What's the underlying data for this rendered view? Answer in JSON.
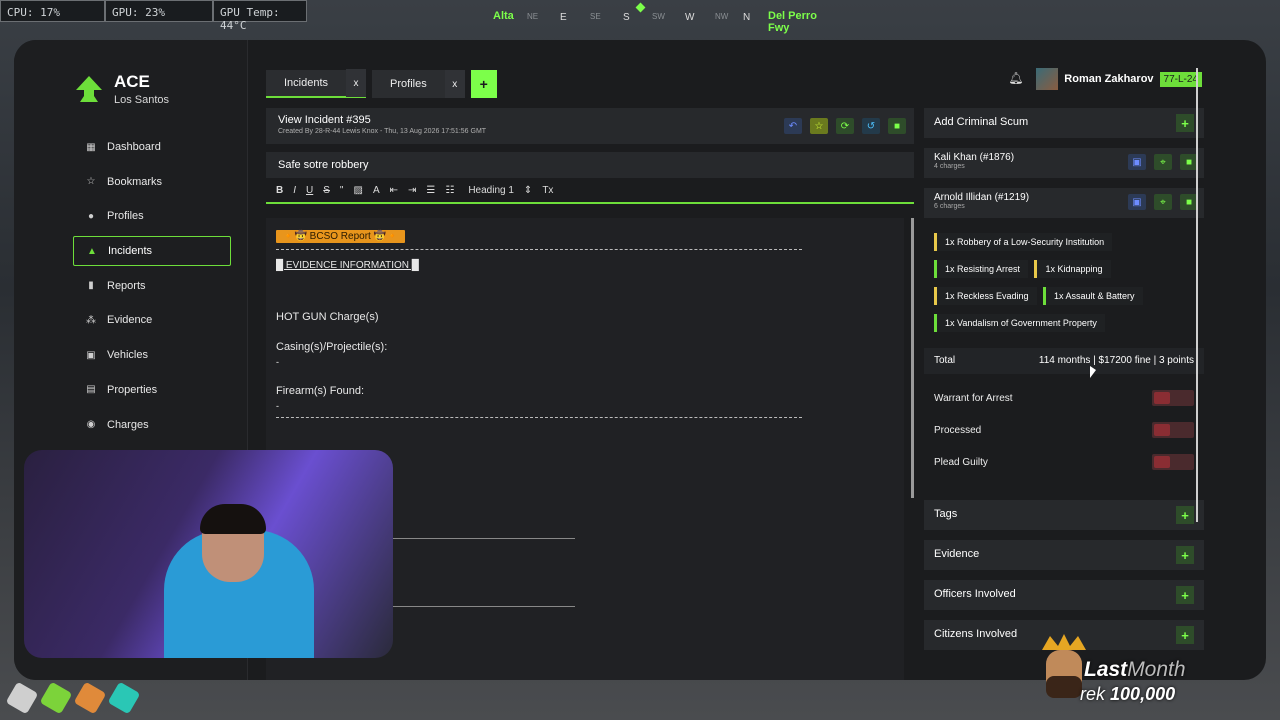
{
  "hud": {
    "cpu": "CPU: 17%",
    "gpu": "GPU: 23%",
    "gpu_temp": "GPU Temp: 44°C"
  },
  "compass": {
    "left_street": "Alta",
    "right_street": "Del Perro Fwy",
    "dirs": [
      "NE",
      "E",
      "SE",
      "S",
      "SW",
      "W",
      "NW",
      "N"
    ]
  },
  "brand": {
    "title": "ACE",
    "subtitle": "Los Santos"
  },
  "nav": [
    {
      "label": "Dashboard",
      "icon": "dashboard-icon"
    },
    {
      "label": "Bookmarks",
      "icon": "star-icon"
    },
    {
      "label": "Profiles",
      "icon": "user-icon"
    },
    {
      "label": "Incidents",
      "icon": "warning-icon",
      "active": true
    },
    {
      "label": "Reports",
      "icon": "file-icon"
    },
    {
      "label": "Evidence",
      "icon": "footprint-icon"
    },
    {
      "label": "Vehicles",
      "icon": "car-icon"
    },
    {
      "label": "Properties",
      "icon": "building-icon"
    },
    {
      "label": "Charges",
      "icon": "pin-icon"
    }
  ],
  "tabs": [
    {
      "label": "Incidents",
      "close": "x"
    },
    {
      "label": "Profiles",
      "close": "x"
    }
  ],
  "tab_add": "+",
  "user": {
    "name": "Roman Zakharov",
    "callsign": "77-L-24"
  },
  "incident": {
    "title": "View Incident #395",
    "meta": "Created By 28-R-44 Lewis Knox - Thu, 13 Aug 2026 17:51:56 GMT",
    "name": "Safe sotre robbery",
    "toolbar": {
      "bold": "B",
      "italic": "I",
      "underline": "U",
      "strike": "S",
      "quote": "\"",
      "heading": "Heading 1",
      "clear": "Tx"
    },
    "body": {
      "badge": "🔸🤠 BCSO Report 🤠🔸",
      "evidence_header": "█ EVIDENCE INFORMATION █",
      "hot_gun": "HOT GUN Charge(s)",
      "casings": "Casing(s)/Projectile(s):",
      "casings_val": "-",
      "firearms": "Firearm(s) Found:",
      "firearms_val": "-"
    }
  },
  "right": {
    "add_criminal": "Add Criminal Scum",
    "criminals": [
      {
        "name": "Kali Khan (#1876)",
        "charges": "4 charges"
      },
      {
        "name": "Arnold Illidan (#1219)",
        "charges": "6 charges"
      }
    ],
    "charges": [
      {
        "label": "1x Robbery of a Low-Security Institution",
        "color": "yellow"
      },
      {
        "label": "1x Resisting Arrest",
        "color": "green"
      },
      {
        "label": "1x Kidnapping",
        "color": "yellow"
      },
      {
        "label": "1x Reckless Evading",
        "color": "yellow"
      },
      {
        "label": "1x Assault & Battery",
        "color": "green"
      },
      {
        "label": "1x Vandalism of Government Property",
        "color": "green"
      }
    ],
    "total_label": "Total",
    "total_value": "114 months | $17200 fine | 3 points",
    "toggles": [
      {
        "label": "Warrant for Arrest"
      },
      {
        "label": "Processed"
      },
      {
        "label": "Plead Guilty"
      }
    ],
    "sections": [
      "Tags",
      "Evidence",
      "Officers Involved",
      "Citizens Involved"
    ]
  },
  "overlay": {
    "last": "Last",
    "month": "Month",
    "rek": "rek",
    "amount": "100,000"
  }
}
